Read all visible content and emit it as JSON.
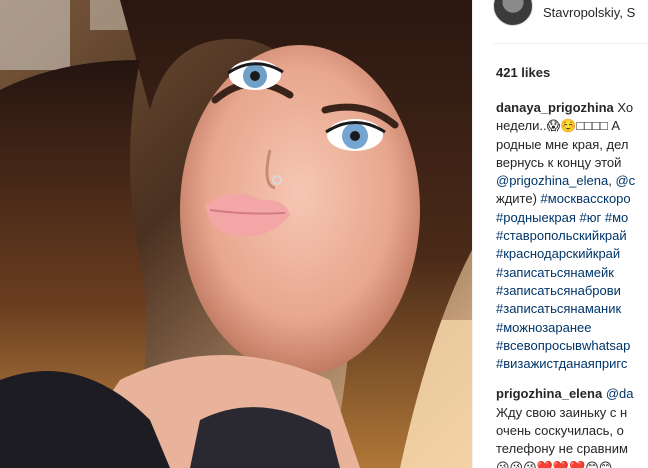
{
  "post": {
    "location": "Stavropolskiy, S",
    "likes": "421 likes"
  },
  "caption": {
    "username": "danaya_prigozhina",
    "first_text": "Хо",
    "lines": [
      "недели..😱☺️□□□□ А",
      "родные мне края, дел",
      "вернусь к концу этой"
    ],
    "mention_line": {
      "mention_1": "@prigozhina_elena",
      "mention_2": "@c"
    },
    "tag_line_prefix": "ждите) ",
    "tag_line_tag": "#москвасскоро",
    "hashtags": [
      "#родныекрая #юг #мо",
      "#ставропольскийкрай",
      "#краснодарскийкрай",
      "#записатьсянамейк",
      "#записатьсянаброви",
      "#записатьсянаманик",
      "#можнозаранее",
      "#всевопросывwhatsap",
      "#визажистданаяпригс"
    ]
  },
  "reply": {
    "username": "prigozhina_elena",
    "mention": "@da",
    "lines": [
      "Жду свою заиньку с н",
      "очень соскучилась, о",
      "телефону не сравним",
      "😘😘😘❤️❤️❤️😊😊"
    ]
  }
}
